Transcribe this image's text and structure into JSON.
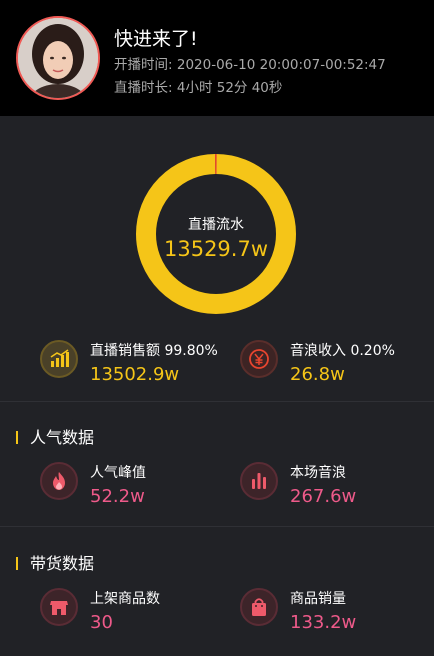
{
  "header": {
    "anchor_name": "快进来了!",
    "start_time_label": "开播时间:",
    "start_time_value": "2020-06-10 20:00:07-00:52:47",
    "duration_label": "直播时长:",
    "duration_value": "4小时 52分 40秒"
  },
  "summary": {
    "donut_label": "直播流水",
    "donut_value": "13529.7w",
    "sales_share_fraction": 0.998,
    "gift_share_fraction": 0.002,
    "colors": {
      "sales": "#f5c518",
      "gift": "#e8452f"
    }
  },
  "revenue": [
    {
      "label": "直播销售额 99.80%",
      "value": "13502.9w",
      "icon": "bar-chart-up-icon"
    },
    {
      "label": "音浪收入 0.20%",
      "value": "26.8w",
      "icon": "yen-coin-icon"
    }
  ],
  "popularity": {
    "title": "人气数据",
    "items": [
      {
        "label": "人气峰值",
        "value": "52.2w",
        "icon": "flame-icon"
      },
      {
        "label": "本场音浪",
        "value": "267.6w",
        "icon": "bars-icon"
      }
    ]
  },
  "goods": {
    "title": "带货数据",
    "items": [
      {
        "label": "上架商品数",
        "value": "30",
        "icon": "storefront-icon"
      },
      {
        "label": "商品销量",
        "value": "133.2w",
        "icon": "shopping-bag-icon"
      }
    ]
  }
}
